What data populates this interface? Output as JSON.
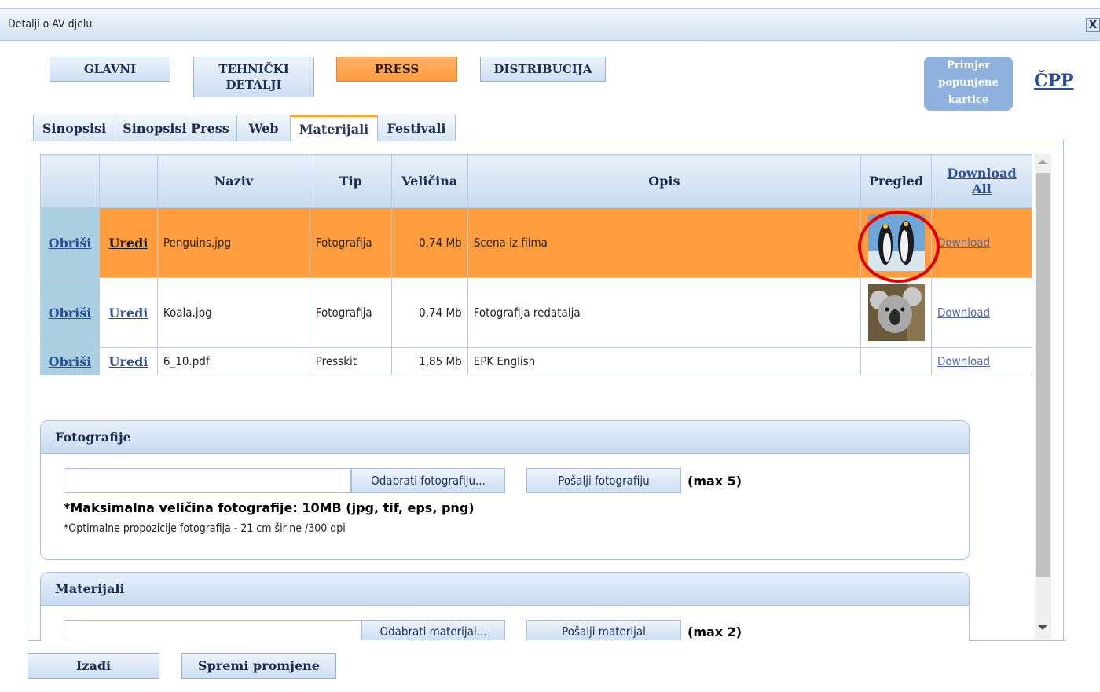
{
  "window": {
    "title": "Detalji o AV djelu",
    "close_label": "X"
  },
  "main_buttons": [
    {
      "label": "GLAVNI"
    },
    {
      "label_line1": "TEHNIČKI",
      "label_line2": "DETALJI"
    },
    {
      "label": "PRESS",
      "active": true
    },
    {
      "label": "DISTRIBUCIJA"
    }
  ],
  "primjer": {
    "line1": "Primjer",
    "line2": "popunjene",
    "line3": "kartice"
  },
  "cpp_link": "ČPP",
  "tabs": [
    {
      "label": "Sinopsisi"
    },
    {
      "label": "Sinopsisi Press"
    },
    {
      "label": "Web"
    },
    {
      "label": "Materijali",
      "active": true
    },
    {
      "label": "Festivali"
    }
  ],
  "table": {
    "headers": {
      "naziv": "Naziv",
      "tip": "Tip",
      "velicina": "Veličina",
      "opis": "Opis",
      "pregled": "Pregled",
      "download_all_1": "Download",
      "download_all_2": "All"
    },
    "rows": [
      {
        "delete": "Obriši",
        "edit": "Uredi",
        "naziv": "Penguins.jpg",
        "tip": "Fotografija",
        "velicina": "0,74 Mb",
        "opis": "Scena iz filma",
        "preview": "penguins-thumbnail",
        "download": "Download",
        "selected": true
      },
      {
        "delete": "Obriši",
        "edit": "Uredi",
        "naziv": "Koala.jpg",
        "tip": "Fotografija",
        "velicina": "0,74 Mb",
        "opis": "Fotografija redatalja",
        "preview": "koala-thumbnail",
        "download": "Download"
      },
      {
        "delete": "Obriši",
        "edit": "Uredi",
        "naziv": "6_10.pdf",
        "tip": "Presskit",
        "velicina": "1,85 Mb",
        "opis": "EPK English",
        "preview": "",
        "download": "Download"
      }
    ]
  },
  "fotografije_panel": {
    "title": "Fotografije",
    "input_value": "",
    "choose_button": "Odabrati fotografiju...",
    "send_button": "Pošalji fotografiju",
    "max_label": "(max 5)",
    "note_bold": "*Maksimalna veličina fotografije: 10MB (jpg, tif, eps, png)",
    "note": "*Optimalne propozicije fotografija - 21 cm širine /300 dpi"
  },
  "materijali_panel": {
    "title": "Materijali",
    "input_value": "",
    "choose_button": "Odabrati materijal...",
    "send_button": "Pošalji materijal",
    "max_label": "(max 2)"
  },
  "bottom_buttons": {
    "exit": "Izađi",
    "save": "Spremi promjene"
  },
  "colors": {
    "accent_orange": "#ff9d3f",
    "header_blue": "#c8dbf0",
    "highlight_red": "#e00000",
    "link_blue": "#2a4e97"
  }
}
